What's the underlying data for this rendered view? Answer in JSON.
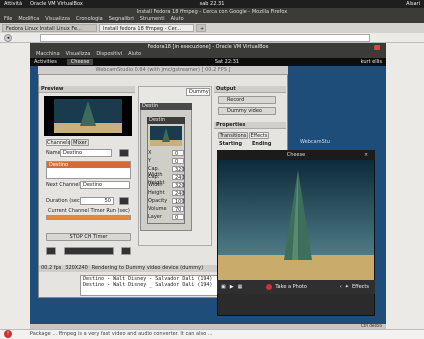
{
  "topbar": {
    "activities": "Attività",
    "app": "Oracle VM VirtualBox",
    "clock": "sab 22.31",
    "user": "Alsari"
  },
  "firefox": {
    "title": "Install Fedora 18 ffmpeg - Cerca con Google - Mozilla Firefox",
    "menu": [
      "File",
      "Modifica",
      "Visualizza",
      "Cronologia",
      "Segnalibri",
      "Strumenti",
      "Aiuto"
    ],
    "tabs": [
      "Fedora Linux Install Linux Fe...",
      "Install fedora 18 ffmpeg - Cer..."
    ],
    "url": "",
    "bottom": "Package  ...  ffmpeg is a very fast video and audio converter. It can also ..."
  },
  "vbox": {
    "title": "Fedora18 [in esecuzione] - Oracle VM VirtualBox",
    "menu": [
      "Macchina",
      "Visualizza",
      "Dispositivi",
      "Aiuto"
    ]
  },
  "guest": {
    "activities": "Activities",
    "app": "Cheese",
    "clock": "Sat 22:31",
    "user": "kurt ellis"
  },
  "app": {
    "header": "WebcamStudio 0.64 (with jmc/gstreamer) [ 00.2 FPS ]",
    "preview_label": "Preview",
    "tabs": [
      "Channels",
      "Mixer"
    ],
    "name_label": "Name",
    "name_value": "Destino",
    "channel_list_item": "Destino",
    "next_channel_label": "Next Channel",
    "next_channel_value": "Destino",
    "duration_label": "Duration (sec)",
    "duration_value": "50",
    "timer_label": "Current Channel Timer Run (sec)",
    "stop_label": "STOP CH Timer",
    "output_label": "Output",
    "record_label": "Record",
    "dummy_label": "Dummy video device...",
    "properties_label": "Properties",
    "prop_tabs": [
      "Transitions",
      "Effects"
    ],
    "starting_label": "Starting",
    "ending_label": "Ending",
    "webcam_label": "WebcamStu",
    "status_fps": "00.2 fps",
    "status_res": "320X240",
    "status_msg": "Rendering to Dummy video device (dummy)"
  },
  "controls": {
    "filters_title": "Destin",
    "panel_title": "Destin",
    "rows": [
      {
        "label": "X",
        "value": "0"
      },
      {
        "label": "Y",
        "value": "0"
      },
      {
        "label": "Cap. Width",
        "value": "320"
      },
      {
        "label": "Cap. Height",
        "value": "240"
      },
      {
        "label": "Width",
        "value": "320"
      },
      {
        "label": "Height",
        "value": "240"
      },
      {
        "label": "Opacity",
        "value": "100"
      },
      {
        "label": "Volume",
        "value": "70"
      },
      {
        "label": "Layer",
        "value": "0"
      }
    ]
  },
  "log": [
    "Destino - Walt Disney - Salvador Dalì (194)",
    "Destino - Walt Disney _ Salvador Dalì (194)"
  ],
  "cheese": {
    "title": "Cheese",
    "take_photo": "Take a Photo",
    "effects": "Effects"
  },
  "vbox_status": "Ctrl destro"
}
